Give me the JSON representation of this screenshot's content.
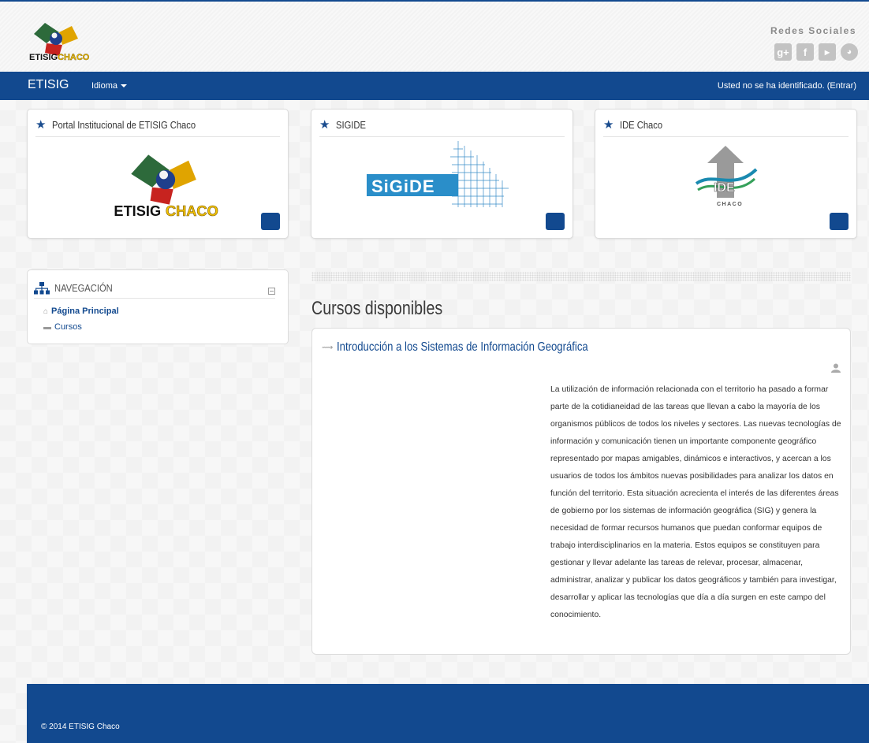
{
  "header": {
    "logo_text_a": "ETISIG",
    "logo_text_b": "CHACO",
    "social_title": "Redes Sociales",
    "social_icons": [
      "google-plus-icon",
      "facebook-icon",
      "youtube-icon",
      "other-social-icon"
    ]
  },
  "navbar": {
    "brand": "ETISIG",
    "language": "Idioma",
    "login_status": "Usted no se ha identificado. (Entrar)"
  },
  "cards": [
    {
      "title": "Portal Institucional de ETISIG Chaco"
    },
    {
      "title": "SIGIDE",
      "logo_text": "SiGiDE"
    },
    {
      "title": "IDE Chaco",
      "logo_text": "IDE",
      "logo_sub": "CHACO"
    }
  ],
  "navigation": {
    "title": "NAVEGACIÓN",
    "items": [
      {
        "label": "Página Principal"
      },
      {
        "label": "Cursos"
      }
    ]
  },
  "courses": {
    "heading": "Cursos disponibles",
    "items": [
      {
        "name": "Introducción a los Sistemas de Información Geográfica",
        "summary": "La utilización de información relacionada con el territorio ha pasado a formar parte de la cotidianeidad de las tareas que llevan a cabo la mayoría de los organismos públicos de todos los niveles y sectores. Las nuevas tecnologías de información y comunicación tienen un importante componente geográfico representado por mapas amigables, dinámicos e interactivos, y acercan a los usuarios de todos los ámbitos nuevas posibilidades para analizar los datos en función del territorio. Esta situación acrecienta el interés de las diferentes áreas de gobierno por los sistemas de información geográfica (SIG) y genera la necesidad de formar recursos humanos que puedan conformar equipos de trabajo interdisciplinarios en la materia. Estos equipos se constituyen para gestionar y llevar adelante las tareas de relevar, procesar, almacenar, administrar, analizar y publicar los datos geográficos y también para investigar, desarrollar y aplicar las tecnologías que día a día surgen en este campo del conocimiento."
      }
    ]
  },
  "footer": {
    "copyright": "© 2014 ETISIG Chaco"
  },
  "colors": {
    "primary": "#12498f",
    "background": "#f7f7f7"
  }
}
